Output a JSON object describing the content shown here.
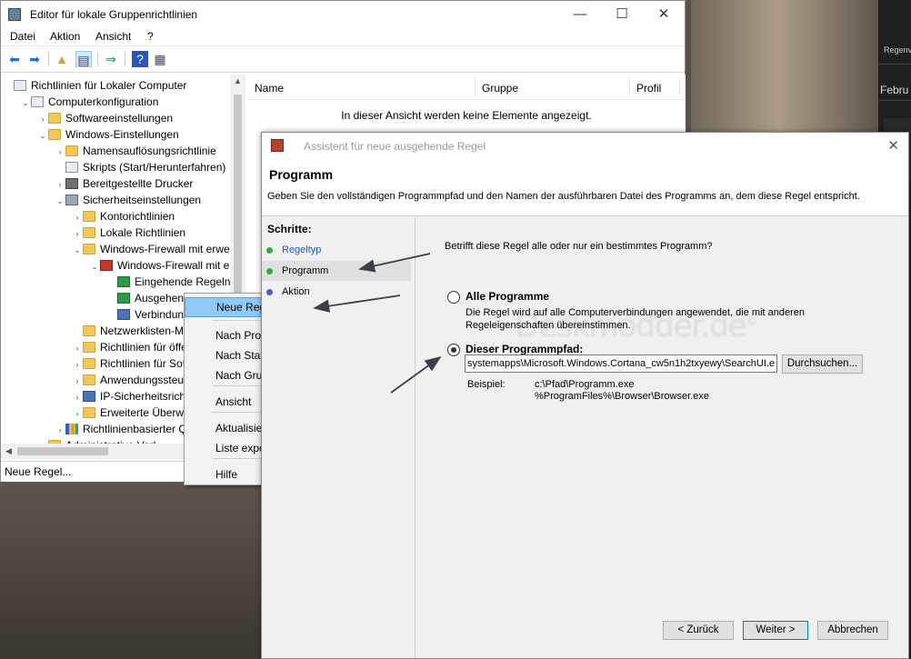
{
  "desktop": {
    "side_text_1": "Regenv",
    "side_text_2": "Febru"
  },
  "main_window": {
    "title": "Editor für lokale Gruppenrichtlinien",
    "menu": [
      "Datei",
      "Aktion",
      "Ansicht",
      "?"
    ],
    "tree": [
      {
        "label": "Richtlinien für Lokaler Computer",
        "icon": "doc-icon",
        "indent": 0,
        "expander": ""
      },
      {
        "label": "Computerkonfiguration",
        "icon": "computer-icon",
        "indent": 1,
        "expander": "v"
      },
      {
        "label": "Softwareeinstellungen",
        "icon": "folder-icon",
        "indent": 2,
        "expander": ">"
      },
      {
        "label": "Windows-Einstellungen",
        "icon": "folder-icon",
        "indent": 2,
        "expander": "v"
      },
      {
        "label": "Namensauflösungsrichtlinie",
        "icon": "folder-icon",
        "indent": 3,
        "expander": ">"
      },
      {
        "label": "Skripts (Start/Herunterfahren)",
        "icon": "script-icon",
        "indent": 3,
        "expander": ""
      },
      {
        "label": "Bereitgestellte Drucker",
        "icon": "printer-icon",
        "indent": 3,
        "expander": ">"
      },
      {
        "label": "Sicherheitseinstellungen",
        "icon": "key-icon",
        "indent": 3,
        "expander": "v"
      },
      {
        "label": "Kontorichtlinien",
        "icon": "folder-icon",
        "indent": 4,
        "expander": ">"
      },
      {
        "label": "Lokale Richtlinien",
        "icon": "folder-icon",
        "indent": 4,
        "expander": ">"
      },
      {
        "label": "Windows-Firewall mit erwei",
        "icon": "folder-icon",
        "indent": 4,
        "expander": "v"
      },
      {
        "label": "Windows-Firewall mit er",
        "icon": "firewall-icon",
        "indent": 5,
        "expander": "v"
      },
      {
        "label": "Eingehende Regeln",
        "icon": "rules-icon",
        "indent": 6,
        "expander": ""
      },
      {
        "label": "Ausgehende Regeln",
        "icon": "rules-icon",
        "indent": 6,
        "expander": ""
      },
      {
        "label": "Verbindungssicherheitsregeln",
        "icon": "connection-icon",
        "indent": 6,
        "expander": ""
      },
      {
        "label": "Netzwerklisten-Ma",
        "icon": "folder-icon",
        "indent": 4,
        "expander": ""
      },
      {
        "label": "Richtlinien für öffe",
        "icon": "folder-icon",
        "indent": 4,
        "expander": ">"
      },
      {
        "label": "Richtlinien für Soft",
        "icon": "folder-icon",
        "indent": 4,
        "expander": ">"
      },
      {
        "label": "Anwendungssteue",
        "icon": "folder-icon",
        "indent": 4,
        "expander": ">"
      },
      {
        "label": "IP-Sicherheitsricht",
        "icon": "ipsec-icon",
        "indent": 4,
        "expander": ">"
      },
      {
        "label": "Erweiterte Überwac",
        "icon": "folder-icon",
        "indent": 4,
        "expander": ">"
      },
      {
        "label": "Richtlinienbasierter Qo",
        "icon": "chart-icon",
        "indent": 3,
        "expander": ">"
      },
      {
        "label": "Administrative Vorl",
        "icon": "folder-icon",
        "indent": 2,
        "expander": ">"
      }
    ],
    "list_columns": [
      "Name",
      "Gruppe",
      "Profil"
    ],
    "empty_message": "In dieser Ansicht werden keine Elemente angezeigt.",
    "status_text": "Neue Regel..."
  },
  "context_menu": {
    "items": [
      {
        "label": "Neue Regel...",
        "submenu": false,
        "highlighted": true
      },
      {
        "label": "Nach Profil filtern",
        "submenu": true
      },
      {
        "label": "Nach Status filtern",
        "submenu": true
      },
      {
        "label": "Nach Gruppe filtern",
        "submenu": true
      },
      {
        "label": "Ansicht",
        "submenu": true
      },
      {
        "label": "Aktualisieren",
        "submenu": false
      },
      {
        "label": "Liste exportieren...",
        "submenu": false
      },
      {
        "label": "Hilfe",
        "submenu": false
      }
    ]
  },
  "wizard": {
    "title": "Assistent für neue ausgehende Regel",
    "heading": "Programm",
    "description": "Geben Sie den vollständigen Programmpfad und den Namen der ausführbaren Datei des Programms an, dem diese Regel entspricht.",
    "steps_title": "Schritte:",
    "steps": [
      {
        "label": "Regeltyp",
        "state": "done"
      },
      {
        "label": "Programm",
        "state": "current"
      },
      {
        "label": "Aktion",
        "state": "pending"
      }
    ],
    "question": "Betrifft diese Regel alle oder nur ein bestimmtes Programm?",
    "option_all": "Alle Programme",
    "option_all_desc": "Die Regel wird auf alle Computerverbindungen angewendet, die mit anderen Regeleigenschaften übereinstimmen.",
    "option_path": "Dieser Programmpfad:",
    "path_value": "systemapps\\Microsoft.Windows.Cortana_cw5n1h2txyewy\\SearchUI.exe",
    "browse_button": "Durchsuchen...",
    "example_label": "Beispiel:",
    "example_line1": "c:\\Pfad\\Programm.exe",
    "example_line2": "%ProgramFiles%\\Browser\\Browser.exe",
    "back_button": "< Zurück",
    "next_button": "Weiter >",
    "cancel_button": "Abbrechen",
    "watermark": "Deskmodder.de",
    "selected_option": "path"
  }
}
